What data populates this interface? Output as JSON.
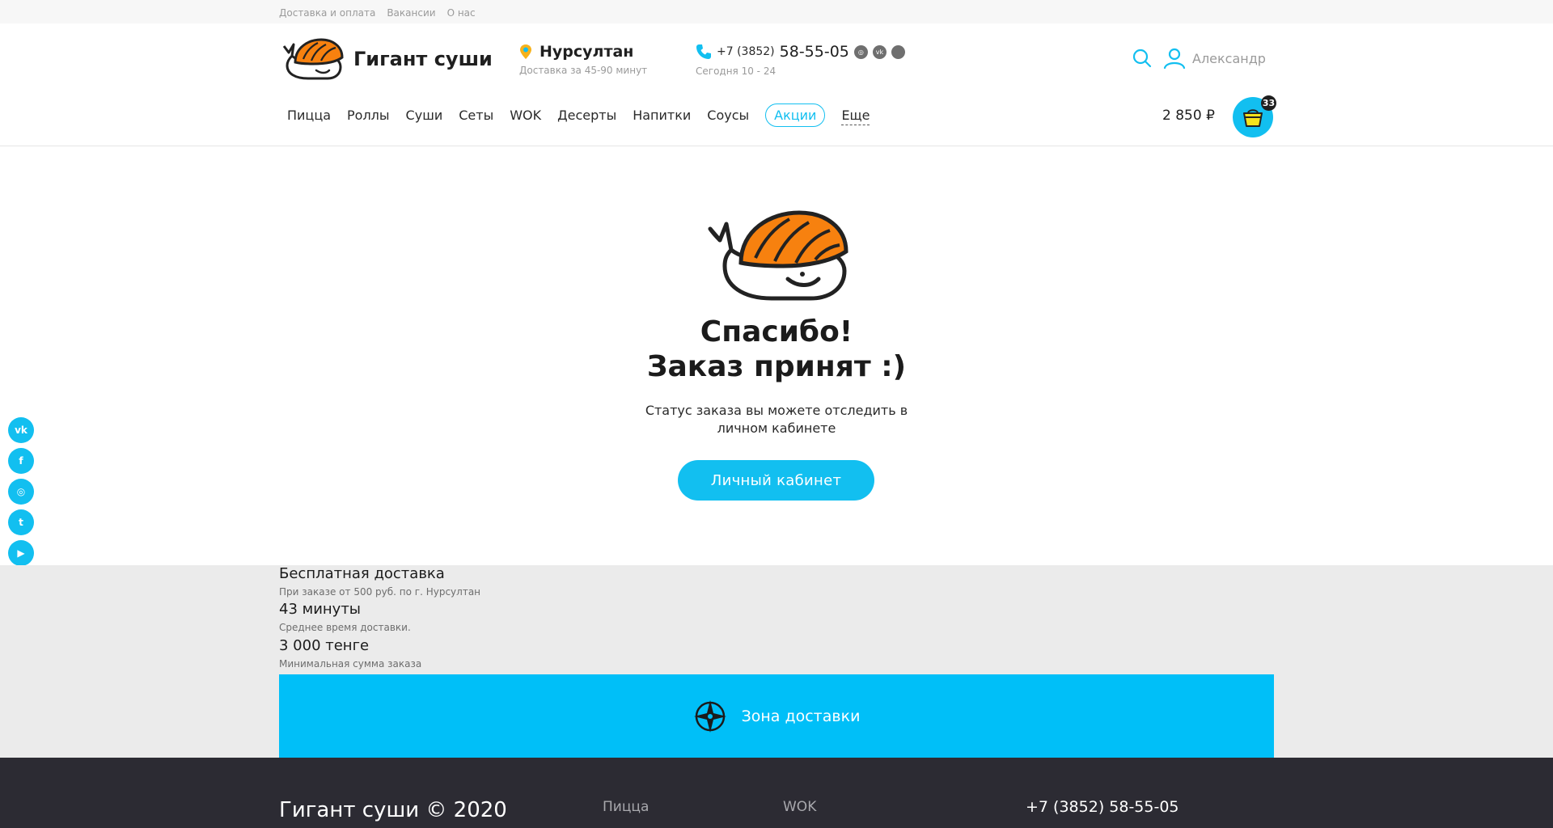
{
  "topbar": {
    "links": [
      "Доставка и оплата",
      "Вакансии",
      "О нас"
    ]
  },
  "header": {
    "logo_title": "Гигант суши",
    "city": "Нурсултан",
    "delivery_time": "Доставка за 45-90 минут",
    "phone_code": "+7 (3852)",
    "phone_number": "58-55-05",
    "hours": "Сегодня 10 - 24",
    "user_name": "Александр"
  },
  "nav": {
    "items": [
      "Пицца",
      "Роллы",
      "Суши",
      "Сеты",
      "WOK",
      "Десерты",
      "Напитки",
      "Соусы"
    ],
    "promo": "Акции",
    "more": "Еще"
  },
  "cart": {
    "total": "2 850 ₽",
    "count": "33"
  },
  "main": {
    "title_line1": "Спасибо!",
    "title_line2": "Заказ принят :)",
    "text": "Статус заказа вы можете отследить в личном кабинете",
    "button": "Личный кабинет"
  },
  "side_social": [
    "vk",
    "fb",
    "ig",
    "tw",
    "yt"
  ],
  "side_social_icons": [
    "vk-icon",
    "facebook-icon",
    "instagram-icon",
    "twitter-icon",
    "youtube-icon"
  ],
  "info": {
    "free_title": "Бесплатная доставка",
    "free_sub": "При заказе от 500 руб. по г. Нурсултан",
    "time_title": "43 минуты",
    "time_sub": "Среднее время доставки.",
    "min_title": "3 000 тенге",
    "min_sub": "Минимальная сумма заказа",
    "zone_button": "Зона доставки"
  },
  "footer": {
    "copyright": "Гигант суши © 2020",
    "link1": "Пицца",
    "link2": "WOK",
    "phone": "+7 (3852) 58-55-05"
  },
  "colors": {
    "accent": "#12bff0",
    "salmon": "#f7810f",
    "footer_bg": "#2c2b33"
  }
}
